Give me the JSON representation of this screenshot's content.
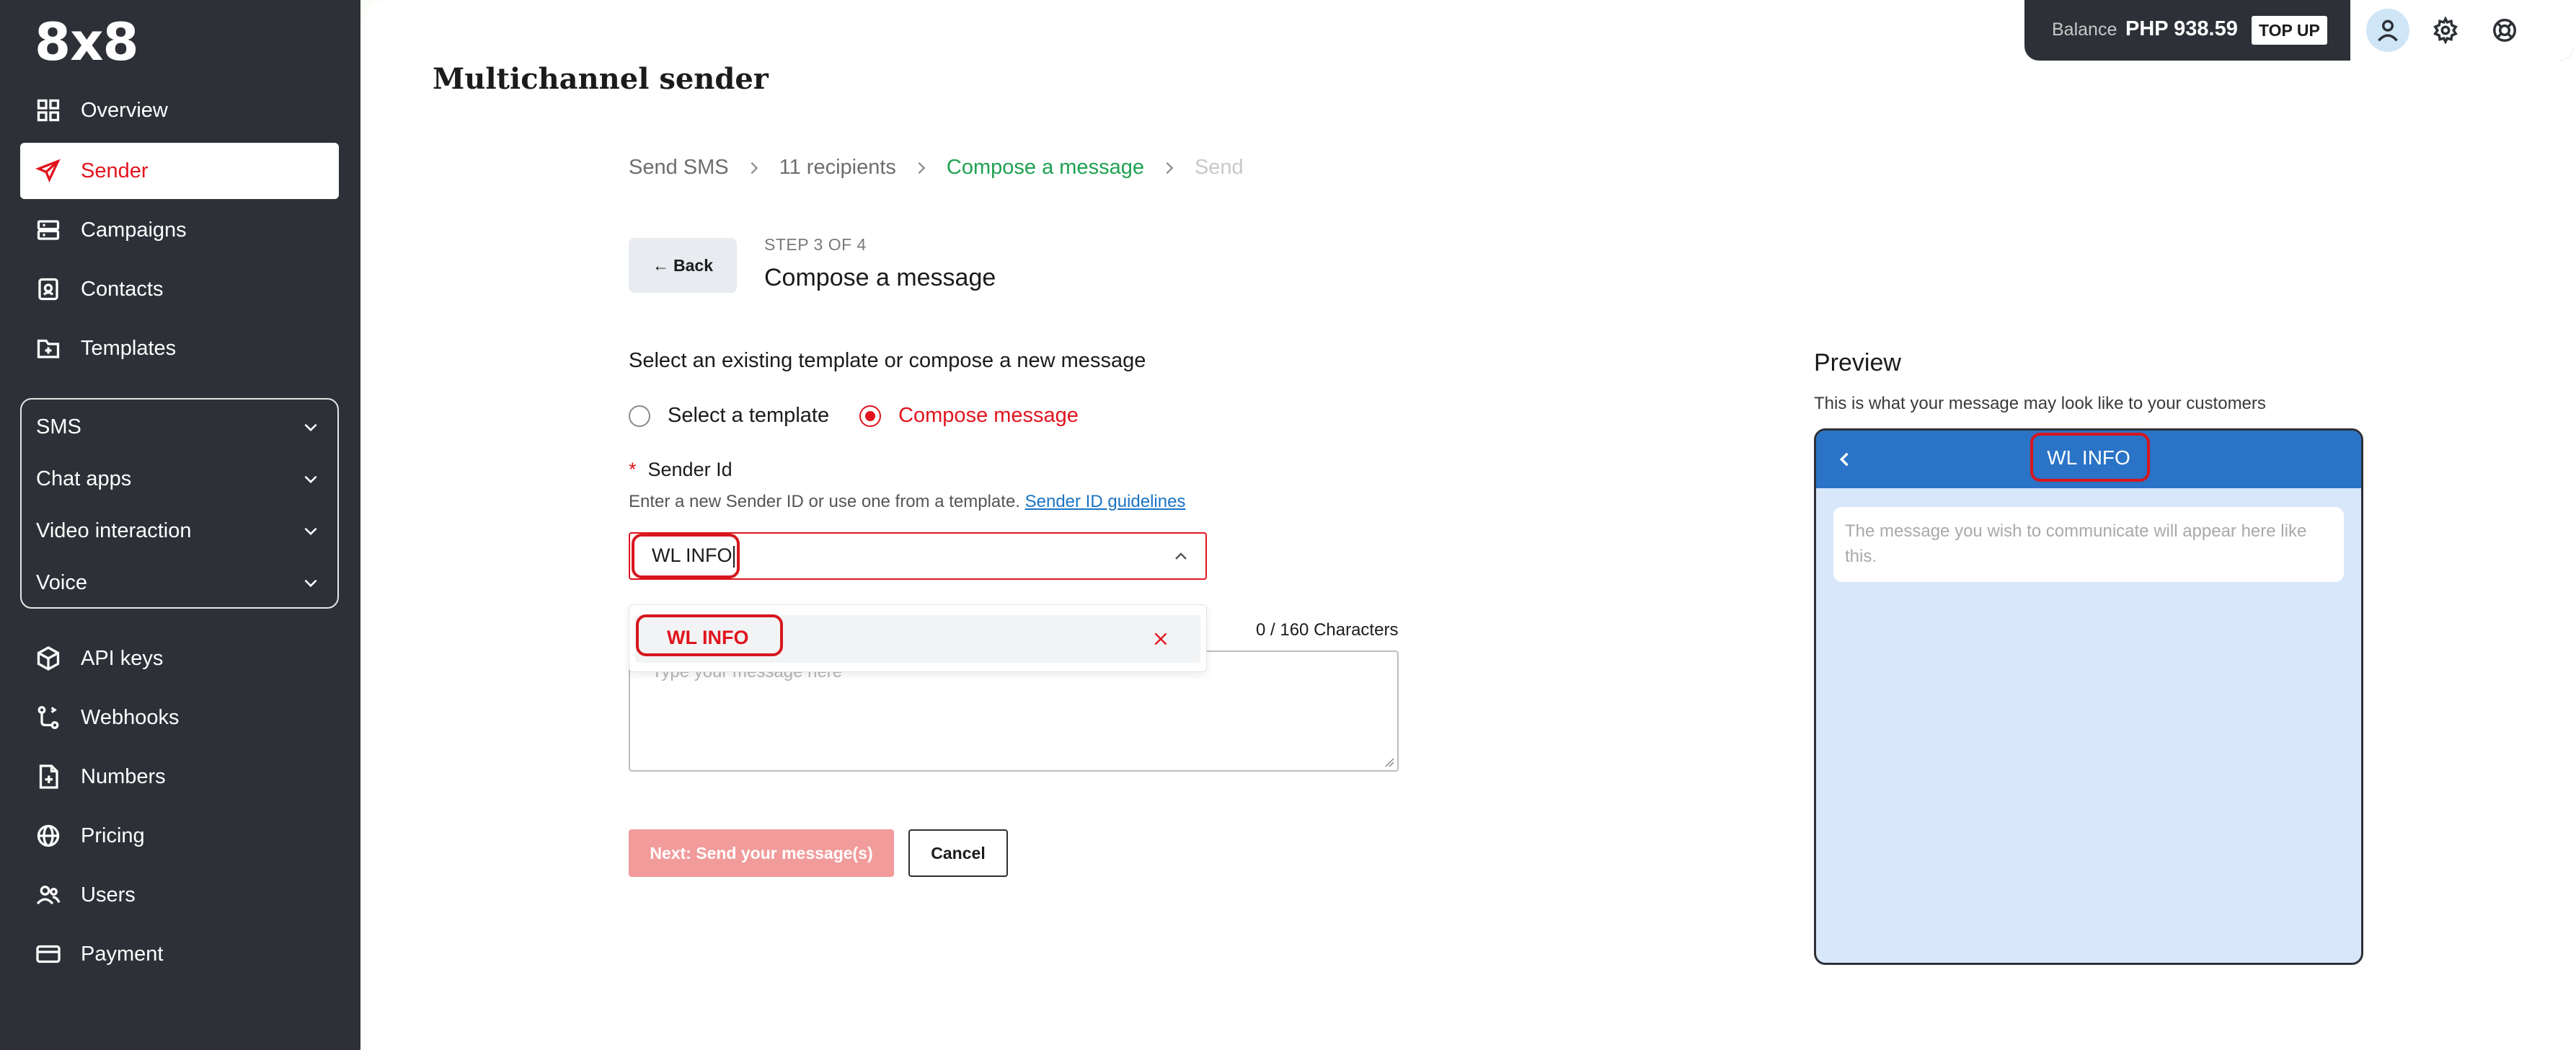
{
  "brand": {
    "logo_text": "8x8"
  },
  "sidebar": {
    "items": [
      {
        "label": "Overview",
        "icon": "grid-icon"
      },
      {
        "label": "Sender",
        "icon": "send-icon",
        "active": true
      },
      {
        "label": "Campaigns",
        "icon": "campaigns-icon"
      },
      {
        "label": "Contacts",
        "icon": "contacts-icon"
      },
      {
        "label": "Templates",
        "icon": "templates-icon"
      }
    ],
    "groups": [
      {
        "label": "SMS"
      },
      {
        "label": "Chat apps"
      },
      {
        "label": "Video interaction"
      },
      {
        "label": "Voice"
      }
    ],
    "bottom_items": [
      {
        "label": "API keys",
        "icon": "box-icon"
      },
      {
        "label": "Webhooks",
        "icon": "webhooks-icon"
      },
      {
        "label": "Numbers",
        "icon": "numbers-icon"
      },
      {
        "label": "Pricing",
        "icon": "globe-icon"
      },
      {
        "label": "Users",
        "icon": "users-icon"
      },
      {
        "label": "Payment",
        "icon": "card-icon"
      }
    ]
  },
  "header": {
    "balance_label": "Balance",
    "balance_value": "PHP 938.59",
    "topup_label": "TOP UP"
  },
  "page": {
    "title": "Multichannel sender",
    "breadcrumb": [
      "Send SMS",
      "11 recipients",
      "Compose a message",
      "Send"
    ],
    "back_label": "Back",
    "step_label": "STEP 3 OF 4",
    "step_title": "Compose a message",
    "select_prompt": "Select an existing template or compose a new message",
    "radio_template": "Select a template",
    "radio_compose": "Compose message",
    "sender_label": "Sender Id",
    "sender_help": "Enter a new Sender ID or use one from a template.",
    "sender_help_link": "Sender ID guidelines",
    "sender_value": "WL INFO",
    "dropdown_option": "WL INFO",
    "char_count": "0 / 160 Characters",
    "message_placeholder": "Type your message here",
    "next_label": "Next: Send your message(s)",
    "cancel_label": "Cancel"
  },
  "preview": {
    "title": "Preview",
    "subtitle": "This is what your message may look like to your customers",
    "sender_name": "WL INFO",
    "bubble_text": "The message you wish to communicate will appear here like this."
  },
  "colors": {
    "accent": "#e1141d",
    "sidebar_bg": "#2d3036",
    "active_crumb": "#1ea152",
    "phone_header": "#2a73c6",
    "phone_body": "#d9e7fb"
  }
}
